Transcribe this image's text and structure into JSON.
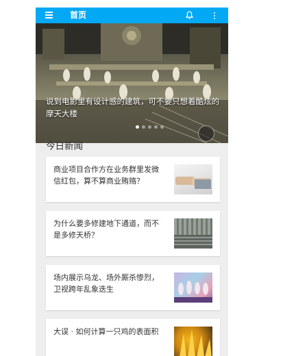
{
  "app_bar": {
    "title": "首页",
    "background": "#03a9f4",
    "icons": [
      "menu-icon",
      "bell-icon",
      "more-vert-icon"
    ]
  },
  "banner": {
    "caption": "说到电影里有设计感的建筑，可不要只想着酷炫的摩天大楼",
    "slides": 5,
    "active_slide": 0
  },
  "section": {
    "title": "今日新闻"
  },
  "news": [
    {
      "title": "商业项目合作方在业务群里发微信红包，算不算商业贿赂？",
      "thumb": "handshake-photo"
    },
    {
      "title": "为什么要多修建地下通道，而不是多修天桥？",
      "thumb": "underpass-photo"
    },
    {
      "title": "场内展示乌龙、场外厮杀惨烈，卫视跨年乱象迭生",
      "thumb": "stage-photo"
    },
    {
      "title": "大误 · 如何计算一只鸡的表面积",
      "thumb": "chicken-photo"
    }
  ]
}
